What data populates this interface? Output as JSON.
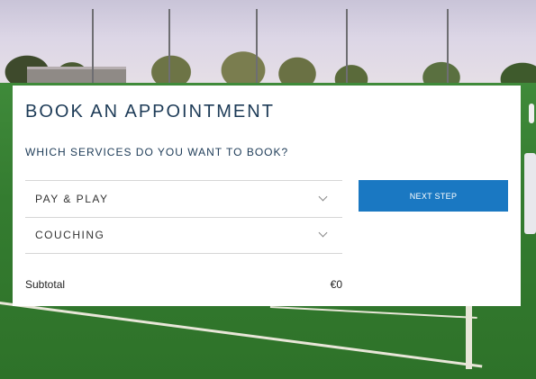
{
  "booking": {
    "title": "BOOK AN APPOINTMENT",
    "subtitle": "WHICH SERVICES DO YOU WANT TO BOOK?",
    "services": [
      {
        "label": "PAY & PLAY",
        "icon": "chevron-down-icon"
      },
      {
        "label": "COUCHING",
        "icon": "chevron-down-icon"
      }
    ],
    "next_button_label": "NEXT STEP",
    "subtotal_label": "Subtotal",
    "subtotal_value": "€0"
  },
  "colors": {
    "accent": "#1a78c2",
    "heading": "#1d3b57",
    "card_background": "#ffffff"
  }
}
